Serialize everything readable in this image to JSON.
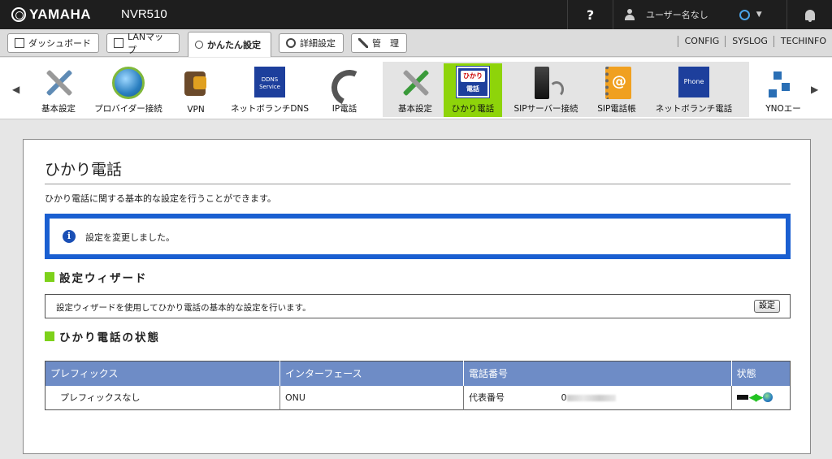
{
  "topbar": {
    "brand": "YAMAHA",
    "model": "NVR510",
    "help": "?",
    "user": "ユーザー名なし",
    "colors": {
      "bar": "#1e1e1e",
      "status_ring": "#4aa3e8"
    }
  },
  "tabs": [
    {
      "label": "ダッシュボード",
      "icon": "dashboard-icon"
    },
    {
      "label": "LANマップ",
      "icon": "lanmap-icon"
    },
    {
      "label": "かんたん設定",
      "icon": "key-wrench-icon",
      "active": true
    },
    {
      "label": "詳細設定",
      "icon": "gear-icon"
    },
    {
      "label": "管　理",
      "icon": "wrench-icon"
    }
  ],
  "toplinks": [
    "CONFIG",
    "SYSLOG",
    "TECHINFO"
  ],
  "icon_strip": {
    "main": [
      {
        "label": "基本設定",
        "icon": "tools-icon"
      },
      {
        "label": "プロバイダー接続",
        "icon": "globe-icon"
      },
      {
        "label": "VPN",
        "icon": "vpn-icon"
      },
      {
        "label": "ネットボランチDNS",
        "icon": "ddns-icon",
        "badge": "DDNS Service"
      },
      {
        "label": "IP電話",
        "icon": "phone-icon"
      }
    ],
    "sub": [
      {
        "label": "基本設定",
        "icon": "tools-icon"
      },
      {
        "label": "ひかり電話",
        "icon": "hikari-denwa-icon",
        "selected": true,
        "badge_top": "ひかり",
        "badge_bottom": "電話"
      },
      {
        "label": "SIPサーバー接続",
        "icon": "sip-server-icon"
      },
      {
        "label": "SIP電話帳",
        "icon": "phonebook-icon"
      },
      {
        "label": "ネットボランチ電話",
        "icon": "netvolante-phone-icon",
        "badge": "Phone"
      }
    ],
    "more": {
      "label": "YNOエー",
      "icon": "yno-icon"
    }
  },
  "page": {
    "title": "ひかり電話",
    "description": "ひかり電話に関する基本的な設定を行うことができます。",
    "notice": "設定を変更しました。",
    "wizard_heading": "設定ウィザード",
    "wizard_text": "設定ウィザードを使用してひかり電話の基本的な設定を行います。",
    "wizard_button": "設定",
    "status_heading": "ひかり電話の状態",
    "table": {
      "headers": [
        "プレフィックス",
        "インターフェース",
        "電話番号",
        "状態"
      ],
      "rows": [
        {
          "prefix": "プレフィックスなし",
          "interface": "ONU",
          "number_label": "代表番号",
          "number_value": "0",
          "status": "connected"
        }
      ]
    },
    "colors": {
      "notice_border": "#1a5fd1",
      "section_marker": "#7dd11a",
      "table_header": "#6e8cc6",
      "selected_icon_bg": "#8ed40a"
    }
  }
}
